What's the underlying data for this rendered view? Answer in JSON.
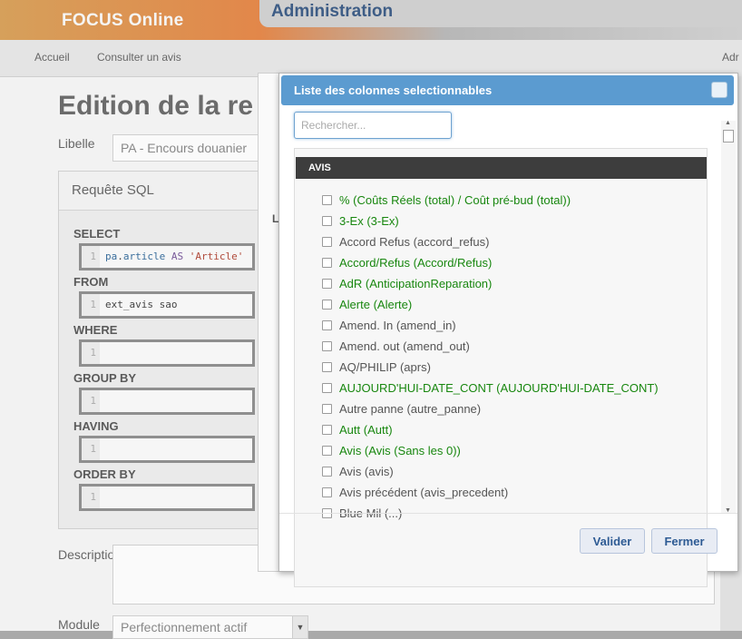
{
  "app": {
    "brand": "FOCUS Online",
    "section": "Administration"
  },
  "nav": {
    "items": [
      "Accueil",
      "Consulter un avis"
    ],
    "right_item": "Adr"
  },
  "page": {
    "title": "Edition de la re",
    "libelle_label": "Libelle",
    "libelle_value": "PA - Encours douanier",
    "sql_panel_title": "Requête SQL",
    "clauses": [
      {
        "keyword": "SELECT",
        "line": "1"
      },
      {
        "keyword": "FROM",
        "line": "1",
        "code": "ext_avis sao"
      },
      {
        "keyword": "WHERE",
        "line": "1",
        "code": ""
      },
      {
        "keyword": "GROUP BY",
        "line": "1",
        "code": ""
      },
      {
        "keyword": "HAVING",
        "line": "1",
        "code": ""
      },
      {
        "keyword": "ORDER BY",
        "line": "1",
        "code": ""
      }
    ],
    "select_code": {
      "tbl": "pa",
      "col": "article",
      "as": "AS",
      "str": "'Article'"
    },
    "description_label": "Descriptio",
    "module_label": "Module",
    "module_value": "Perfectionnement actif",
    "back_letter": "L"
  },
  "modal": {
    "title": "Liste des colonnes selectionnables",
    "search_placeholder": "Rechercher...",
    "group_label": "AVIS",
    "items": [
      {
        "label": "% (Coûts Réels (total) / Coût pré-bud (total))",
        "color": "#18870f"
      },
      {
        "label": "3-Ex (3-Ex)",
        "color": "#18870f"
      },
      {
        "label": "Accord Refus (accord_refus)",
        "color": "#555555"
      },
      {
        "label": "Accord/Refus (Accord/Refus)",
        "color": "#18870f"
      },
      {
        "label": "AdR (AnticipationReparation)",
        "color": "#18870f"
      },
      {
        "label": "Alerte (Alerte)",
        "color": "#18870f"
      },
      {
        "label": "Amend. In (amend_in)",
        "color": "#555555"
      },
      {
        "label": "Amend. out (amend_out)",
        "color": "#555555"
      },
      {
        "label": "AQ/PHILIP (aprs)",
        "color": "#555555"
      },
      {
        "label": "AUJOURD'HUI-DATE_CONT (AUJOURD'HUI-DATE_CONT)",
        "color": "#18870f"
      },
      {
        "label": "Autre panne (autre_panne)",
        "color": "#555555"
      },
      {
        "label": "Autt (Autt)",
        "color": "#18870f"
      },
      {
        "label": "Avis (Avis (Sans les 0))",
        "color": "#18870f"
      },
      {
        "label": "Avis (avis)",
        "color": "#555555"
      },
      {
        "label": "Avis précédent (avis_precedent)",
        "color": "#555555"
      },
      {
        "label": "Blue Mil (...)",
        "color": "#555555"
      }
    ],
    "validate_label": "Valider",
    "close_label": "Fermer"
  }
}
